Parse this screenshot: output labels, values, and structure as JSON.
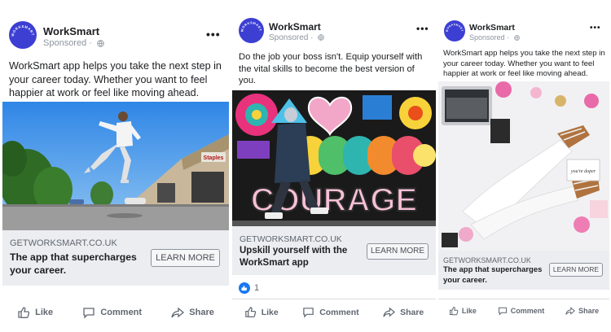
{
  "ads": [
    {
      "brand": "WorkSmart",
      "sponsored": "Sponsored",
      "avatar_text": "WORKSMART",
      "body": "WorkSmart app helps you take the next step in your career today. Whether you want to feel happier at work or feel like moving ahead.",
      "domain": "GETWORKSMART.CO.UK",
      "headline": "The app that supercharges your career.",
      "cta": "LEARN MORE",
      "store_sign": "Staples",
      "actions": {
        "like": "Like",
        "comment": "Comment",
        "share": "Share"
      }
    },
    {
      "brand": "WorkSmart",
      "sponsored": "Sponsored",
      "avatar_text": "WORKSMART",
      "body": "Do the job your boss isn't. Equip yourself with the vital skills to become the best version of you.",
      "mural_text": "COURAGE",
      "domain": "GETWORKSMART.CO.UK",
      "headline": "Upskill yourself with the WorkSmart app",
      "cta": "LEARN MORE",
      "reaction_count": "1",
      "actions": {
        "like": "Like",
        "comment": "Comment",
        "share": "Share"
      }
    },
    {
      "brand": "WorkSmart",
      "sponsored": "Sponsored",
      "avatar_text": "WORKSMART",
      "body": "WorkSmart app helps you take the next step in your career today. Whether you want to feel happier at work or feel like moving ahead.",
      "desk_note": "you're doper",
      "domain": "GETWORKSMART.CO.UK",
      "headline": "The app that supercharges your career.",
      "cta": "LEARN MORE",
      "actions": {
        "like": "Like",
        "comment": "Comment",
        "share": "Share"
      }
    }
  ],
  "colors": {
    "brand_blue": "#3c3fd2",
    "facebook_blue": "#1877f2",
    "panel_gray": "#ebedf0",
    "muted_text": "#606770"
  },
  "icons": [
    "globe-icon",
    "more-icon",
    "like-icon",
    "comment-icon",
    "share-icon",
    "like-reaction-icon"
  ]
}
